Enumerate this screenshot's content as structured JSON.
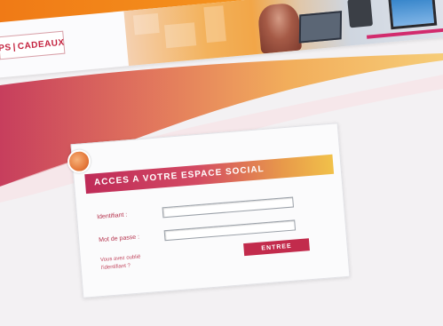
{
  "header": {
    "logo_left": "PS",
    "logo_separator": "|",
    "logo_right": "CADEAUX"
  },
  "login": {
    "title": "ACCES A VOTRE ESPACE SOCIAL",
    "identifier_label": "Identifiant :",
    "identifier_value": "",
    "password_label": "Mot de passe :",
    "password_value": "",
    "submit_label": "ENTREE",
    "forgot_line1": "Vous avez oublié",
    "forgot_line2": "l'identifiant ?"
  },
  "colors": {
    "accent": "#c22b4c",
    "orange": "#f07a16"
  }
}
